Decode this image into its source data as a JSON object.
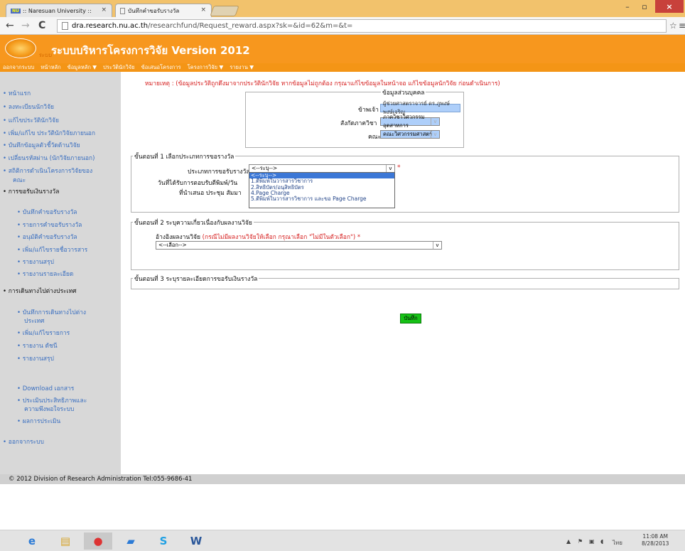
{
  "browser": {
    "tabs": [
      {
        "label": ":: Naresuan University ::",
        "icon_text": "NU"
      },
      {
        "label": "บันทึกคำขอรับรางวัล"
      }
    ],
    "close_glyph": "×",
    "url_host": "dra.research.nu.ac.th",
    "url_path": "/researchfund/Request_reward.aspx?sk=&id=62&m=&t="
  },
  "app": {
    "logo_text": "ระบบ",
    "title": "ระบบบริหารโครงการวิจัย Version 2012",
    "menu": [
      "ออกจากระบบ",
      "หน้าหลัก",
      "ข้อมูลหลัก ▼",
      "ประวัตินักวิจัย",
      "ข้อเสนอโครงการ",
      "โครงการวิจัย ▼",
      "รายงาน ▼"
    ]
  },
  "sidebar": {
    "main": [
      "หน้าแรก",
      "ลงทะเบียนนักวิจัย",
      "แก้ไขประวัตินักวิจัย",
      "เพิ่ม/แก้ไข ประวัตินักวิจัยภายนอก",
      "บันทึกข้อมูลตัวชี้วัดด้านวิจัย",
      "เปลี่ยนรหัสผ่าน (นักวิจัยภายนอก)",
      "สถิติการดำเนินโครงการวิจัยของ",
      "คณะ"
    ],
    "reward_header": "การขอรับเงินรางวัล",
    "reward_items": [
      "บันทึกคำขอรับรางวัล",
      "รายการคำขอรับรางวัล",
      "อนุมัติคำขอรับรางวัล",
      "เพิ่ม/แก้ไขรายชื่อวารสาร",
      "รายงานสรุป",
      "รายงานรายละเอียด"
    ],
    "travel_header": "การเดินทางไปต่างประเทศ",
    "travel_items": [
      "บันทึกการเดินทางไปต่าง",
      "ประเทศ",
      "เพิ่ม/แก้ไขรายการ",
      "รายงาน ดัชนี",
      "รายงานสรุป"
    ],
    "other_items": [
      "Download เอกสาร",
      "ประเมินประสิทธิภาพและ",
      "ความพึงพอใจระบบ",
      "ผลการประเมิน"
    ],
    "logout": "ออกจากระบบ"
  },
  "note": "หมายเหตุ : (ข้อมูลประวัติถูกดึงมาจากประวัตินักวิจัย หากข้อมูลไม่ถูกต้อง กรุณาแก้ไขข้อมูลในหน้าจอ แก้ไขข้อมูลนักวิจัย ก่อนดำเนินการ)",
  "personal": {
    "legend": "ข้อมูลส่วนบุคคล",
    "name_label": "ข้าพเจ้า",
    "name_value": "ผู้ช่วยศาสตราจารย์ ดร.ภูพงษ์  พงษ์เจริญ",
    "dept_label": "สังกัดภาควิชา",
    "dept_value": "ภาควิชาวิศวกรรมอุตสาหการ",
    "faculty_label": "คณะ",
    "faculty_value": "คณะวิศวกรรมศาสตร์"
  },
  "step1": {
    "legend": "ขั้นตอนที่ 1 เลือกประเภทการขอรางวัล",
    "type_label": "ประเภทการขอรับรางวัล",
    "type_value": "<--ระบุ-->",
    "date_label": "วันที่ได้รับการตอบรับตีพิมพ์/วัน",
    "venue_label": "ที่นำเสนอ ประชุม สัมมา",
    "required": "*",
    "options": [
      "<--ระบุ-->",
      "1.ตีพิมพ์ในวารสารวิชาการ",
      "2.สิทธิบัตร/อนุสิทธิบัตร",
      "4.Page Charge",
      "5.ตีพิมพ์ในวารสารวิชาการ และขอ Page Charge"
    ]
  },
  "step2": {
    "legend": "ขั้นตอนที่ 2 ระบุความเกี่ยวเนื่องกับผลงานวิจัย",
    "ref_label": "อ้างอิงผลงานวิจัย",
    "ref_hint": "(กรณีไม่มีผลงานวิจัยให้เลือก กรุณาเลือก \"ไม่มีในตัวเลือก\") *",
    "ref_value": "<--เลือก-->"
  },
  "step3": {
    "legend": "ขั้นตอนที่ 3 ระบุรายละเอียดการขอรับเงินรางวัล"
  },
  "save_label": "บันทึก",
  "footer": "© 2012 Division of Research Administration Tel:055-9686-41",
  "tray": {
    "lang": "ไทย",
    "time": "11:08 AM",
    "date": "8/28/2013"
  },
  "colors": {
    "banner": "#f7971e",
    "menubar": "#f49516",
    "sidebar": "#d8d8d8",
    "required": "#d62020",
    "link": "#3a6fc0",
    "save": "#16c216"
  }
}
